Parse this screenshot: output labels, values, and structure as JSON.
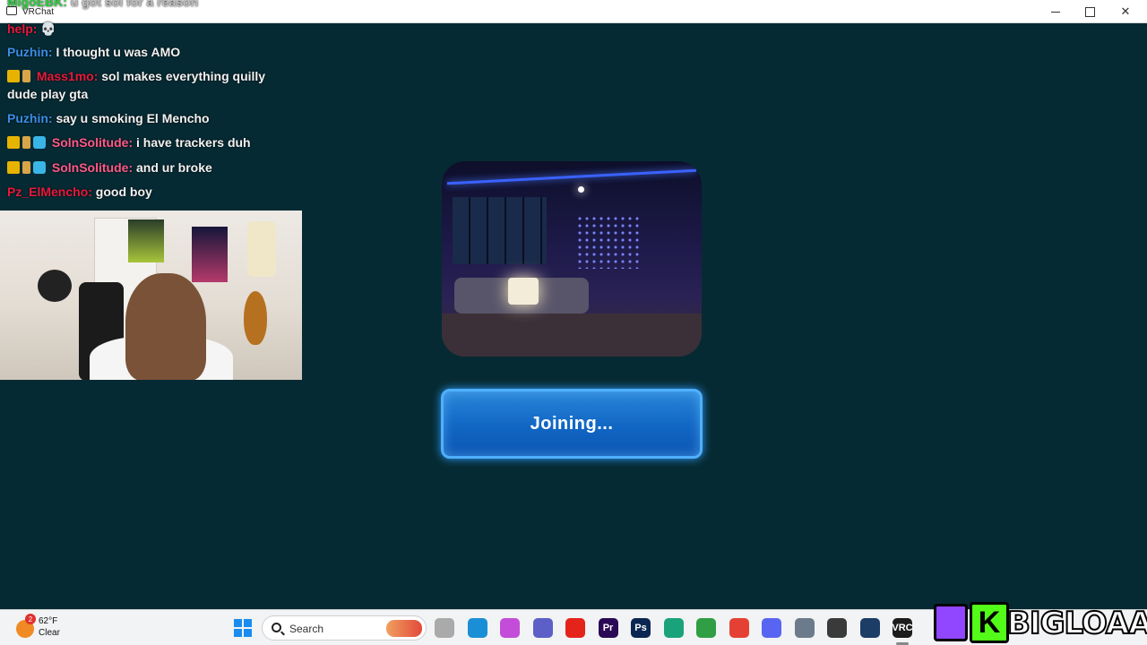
{
  "window": {
    "title": "VRChat",
    "minimize_glyph": "",
    "maximize_glyph": "",
    "close_glyph": "✕"
  },
  "chat": {
    "messages": [
      {
        "user": "MigoEBK:",
        "text": "u got sol for a reason",
        "user_color": "#2ecc40"
      },
      {
        "user": "help:",
        "text": "💀",
        "user_color": "#e8193c"
      },
      {
        "user": "Puzhin:",
        "text": "I thought u was AMO",
        "user_color": "#3a8ee6"
      },
      {
        "user": "Mass1mo:",
        "text": "sol makes everything quilly",
        "text2": "dude play gta",
        "user_color": "#e8193c"
      },
      {
        "user": "Puzhin:",
        "text": "say u smoking El Mencho",
        "user_color": "#3a8ee6"
      },
      {
        "user": "SolnSolitude:",
        "text": "i have trackers duh",
        "user_color": "#ff5a8a"
      },
      {
        "user": "SolnSolitude:",
        "text": "and ur broke",
        "user_color": "#ff5a8a"
      },
      {
        "user": "Pz_ElMencho:",
        "text": "good boy",
        "user_color": "#e8193c"
      }
    ]
  },
  "loading": {
    "join_label": "Joining..."
  },
  "taskbar": {
    "weather": {
      "temp": "62°F",
      "condition": "Clear",
      "badge": "2"
    },
    "search_placeholder": "Search",
    "apps": [
      {
        "name": "file-explorer",
        "label": "",
        "color": "#aaaaaa"
      },
      {
        "name": "edge",
        "label": "",
        "color": "#1b8fd6"
      },
      {
        "name": "copilot",
        "label": "",
        "color": "#c34dd8"
      },
      {
        "name": "teams",
        "label": "",
        "color": "#5b5fc7"
      },
      {
        "name": "red-app",
        "label": "",
        "color": "#e4231b"
      },
      {
        "name": "premiere",
        "label": "Pr",
        "color": "#2a0a55"
      },
      {
        "name": "photoshop",
        "label": "Ps",
        "color": "#0b2650"
      },
      {
        "name": "chat-app",
        "label": "",
        "color": "#1aa37a"
      },
      {
        "name": "chrome-2",
        "label": "",
        "color": "#2f9e44"
      },
      {
        "name": "chrome",
        "label": "",
        "color": "#e44134"
      },
      {
        "name": "discord",
        "label": "",
        "color": "#5865f2"
      },
      {
        "name": "settings",
        "label": "",
        "color": "#6b7b8c"
      },
      {
        "name": "obs",
        "label": "",
        "color": "#3a3a3a"
      },
      {
        "name": "steam",
        "label": "",
        "color": "#1b3d66"
      },
      {
        "name": "vrchat",
        "label": "VRC",
        "color": "#1c1c1c"
      }
    ]
  },
  "streamer": {
    "name": "BIGLOAAF",
    "kick_letter": "K"
  }
}
